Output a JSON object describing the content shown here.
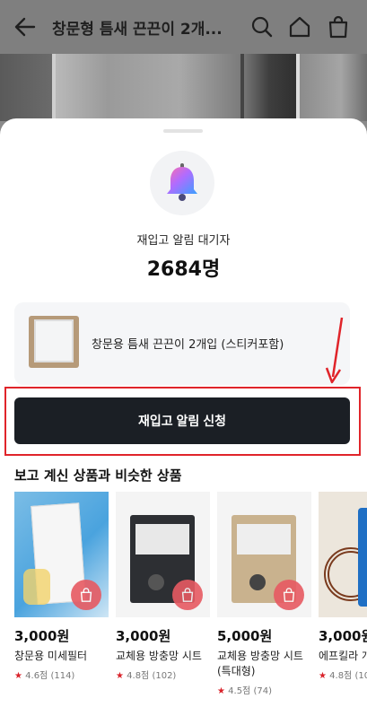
{
  "header": {
    "title": "창문형 틈새 끈끈이 2개...",
    "icons": [
      "back-arrow-icon",
      "search-icon",
      "home-icon",
      "shopping-bag-icon"
    ]
  },
  "sheet": {
    "waitlist_label": "재입고 알림 대기자",
    "waitlist_count": "2684명",
    "product_name": "창문용 틈새 끈끈이 2개입 (스티커포함)",
    "apply_button": "재입고 알림 신청",
    "section_title": "보고 계신 상품과 비슷한 상품"
  },
  "recommendations": [
    {
      "price": "3,000원",
      "name": "창문용 미세필터",
      "rating": "4.6점 (114)"
    },
    {
      "price": "3,000원",
      "name": "교체용 방충망 시트",
      "rating": "4.8점 (102)"
    },
    {
      "price": "5,000원",
      "name": "교체용 방충망 시트 (특대형)",
      "rating": "4.5점 (74)"
    },
    {
      "price": "3,000원",
      "name": "에프킬라 개",
      "rating": "4.8점 (10"
    }
  ],
  "colors": {
    "accent_red": "#e0242a",
    "button_dark": "#1b1f25",
    "star": "#d9222a"
  }
}
